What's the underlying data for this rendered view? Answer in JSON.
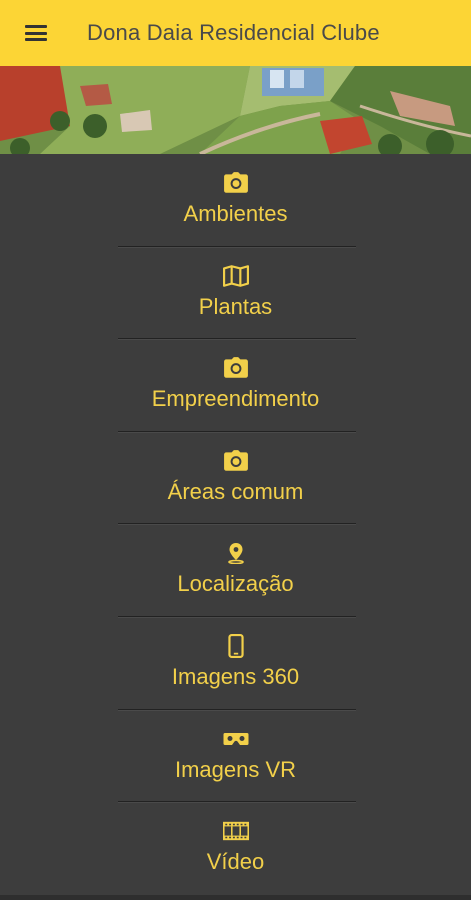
{
  "appbar": {
    "title": "Dona Daia Residencial Clube",
    "menu_icon": "hamburger-menu-icon",
    "background": "#fcd535"
  },
  "theme": {
    "body_bg": "#3d3d3d",
    "accent": "#f2d04a"
  },
  "menu": {
    "items": [
      {
        "label": "Ambientes",
        "icon": "camera-icon"
      },
      {
        "label": "Plantas",
        "icon": "map-icon"
      },
      {
        "label": "Empreendimento",
        "icon": "camera-icon"
      },
      {
        "label": "Áreas comum",
        "icon": "camera-icon"
      },
      {
        "label": "Localização",
        "icon": "location-pin-icon"
      },
      {
        "label": "Imagens 360",
        "icon": "smartphone-icon"
      },
      {
        "label": "Imagens VR",
        "icon": "vr-headset-icon"
      },
      {
        "label": "Vídeo",
        "icon": "film-icon"
      }
    ]
  }
}
